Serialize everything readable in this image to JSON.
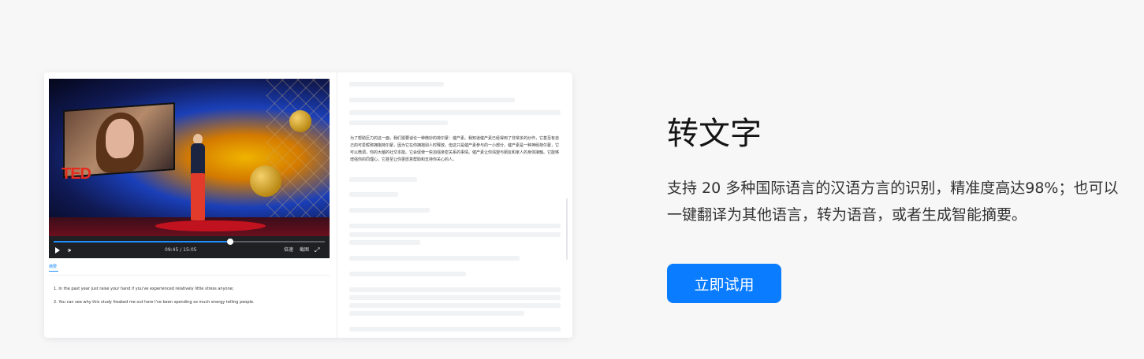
{
  "feature": {
    "title": "转文字",
    "description": "支持 20 多种国际语言的汉语方言的识别，精准度高达98%；也可以一键翻译为其他语言，转为语音，或者生成智能摘要。",
    "cta_label": "立即试用",
    "colors": {
      "accent": "#0a7cff",
      "title_text": "#141414",
      "body_text": "#333333",
      "page_background": "#f7f7f8"
    }
  },
  "preview": {
    "video": {
      "logo_text": "TED",
      "current_time": "09:45",
      "time_separator": "/",
      "duration": "15:05",
      "speed_label": "倍速",
      "screenshot_label": "截图",
      "progress_fraction": 0.65,
      "icons": [
        "play-icon",
        "volume-icon",
        "fullscreen-icon"
      ]
    },
    "tab_label": "摘要",
    "transcript": [
      "1. In the past year just raise your hand if you've experienced relatively little stress anyone;",
      "2. You can see why this study freaked me out here I've been spending so much energy telling people."
    ],
    "paragraph": "为了帮助压力的这一面，我们需要谈论一种微妙的荷尔蒙：催产素。我知道催产素已经得到了非常多的炒作，它甚至有自己的可爱昵称拥抱荷尔蒙，因为它在你拥抱别人时释放。但这只是催产素参与的一小部分。催产素是一种神经荷尔蒙，它可以微调，你的大脑的社交本能。它会促使一些加强亲密关系的事情。催产素让你渴望与朋友和家人的身体接触。它能够增强你的同理心，它甚至让你更愿意帮助和支持你关心的人。"
  }
}
